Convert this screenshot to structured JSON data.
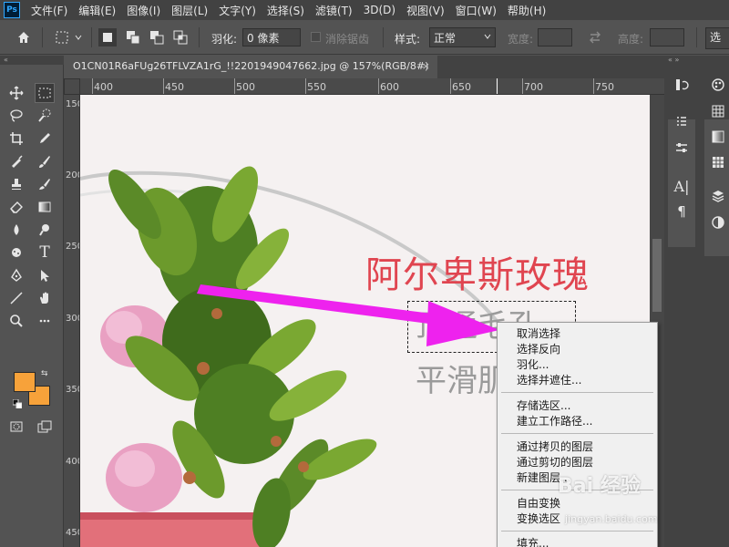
{
  "app": {
    "logo": "Ps"
  },
  "menu": [
    "文件(F)",
    "编辑(E)",
    "图像(I)",
    "图层(L)",
    "文字(Y)",
    "选择(S)",
    "滤镜(T)",
    "3D(D)",
    "视图(V)",
    "窗口(W)",
    "帮助(H)"
  ],
  "options": {
    "feather_label": "羽化:",
    "feather_value": "0 像素",
    "antialias_label": "消除锯齿",
    "style_label": "样式:",
    "style_value": "正常",
    "width_label": "宽度:",
    "height_label": "高度:",
    "select_btn": "选"
  },
  "document": {
    "tab_title": "O1CN01R6aFUg26TFLVZA1rG_!!2201949047662.jpg @ 157%(RGB/8#)",
    "close": "×"
  },
  "ruler": {
    "h_labels": [
      "400",
      "450",
      "500",
      "550",
      "600",
      "650",
      "700",
      "750"
    ],
    "v_labels": [
      "150",
      "200",
      "250",
      "300",
      "350",
      "400",
      "450"
    ]
  },
  "canvas": {
    "headline": "阿尔卑斯玫瑰",
    "sub1": "顶通毛孔",
    "sub2": "平滑肌肤"
  },
  "context_menu": {
    "items": [
      "取消选择",
      "选择反向",
      "羽化...",
      "选择并遮住...",
      "存储选区...",
      "建立工作路径...",
      "通过拷贝的图层",
      "通过剪切的图层",
      "新建图层...",
      "自由变换",
      "变换选区",
      "填充..."
    ]
  },
  "colors": {
    "foreground": "#f7a23a",
    "background": "#f7a23a",
    "arrow": "#ee22ee"
  },
  "watermark": {
    "brand": "Bai 经验",
    "url": "jingyan.baidu.com"
  }
}
